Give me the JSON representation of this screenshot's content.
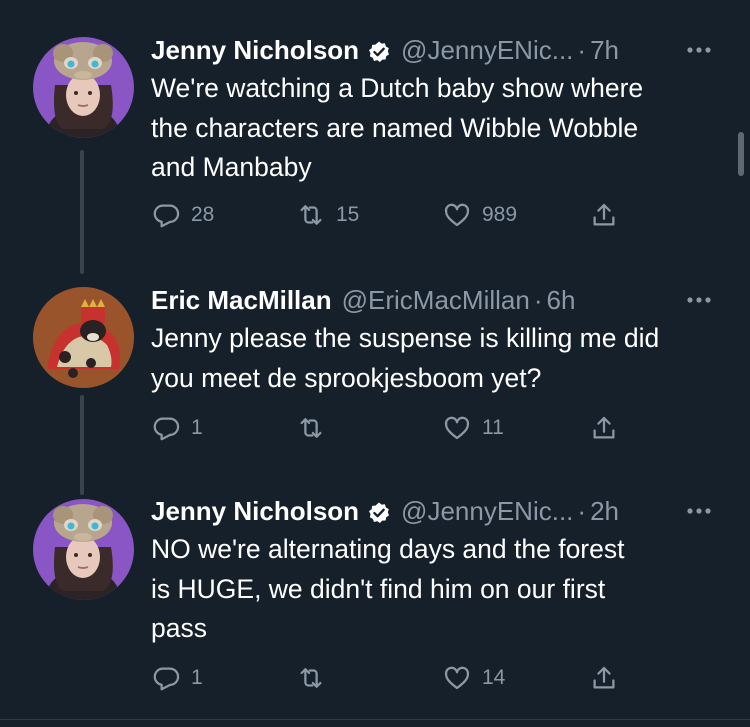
{
  "tweets": [
    {
      "name": "Jenny Nicholson",
      "verified": true,
      "handle": "@JennyENic...",
      "separator": "·",
      "time": "7h",
      "text": "We're watching a Dutch baby show where\nthe characters are named Wibble Wobble\nand Manbaby",
      "replies": "28",
      "retweets": "15",
      "likes": "989"
    },
    {
      "name": "Eric MacMillan",
      "verified": false,
      "handle": "@EricMacMillan",
      "separator": "·",
      "time": "6h",
      "text": "Jenny please the suspense is killing me did\nyou meet de sprookjesboom yet?",
      "replies": "1",
      "retweets": "",
      "likes": "11"
    },
    {
      "name": "Jenny Nicholson",
      "verified": true,
      "handle": "@JennyENic...",
      "separator": "·",
      "time": "2h",
      "text": "NO we're alternating days and the forest\nis HUGE, we didn't find him on our first\npass",
      "replies": "1",
      "retweets": "",
      "likes": "14"
    }
  ],
  "icons": {
    "verified": "verified-badge-icon",
    "more": "more-options-icon",
    "reply": "reply-icon",
    "retweet": "retweet-icon",
    "like": "heart-icon",
    "share": "share-icon"
  },
  "colors": {
    "background": "#15202b",
    "text": "#ffffff",
    "secondary": "#8b98a5",
    "thread_line": "#38444d"
  }
}
